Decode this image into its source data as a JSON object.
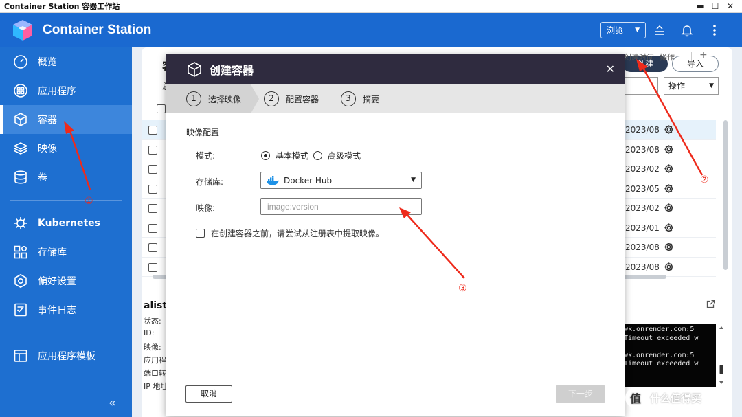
{
  "os": {
    "title": "Container Station 容器工作站",
    "min": "▬",
    "max": "☐",
    "close": "✕"
  },
  "header": {
    "app_name": "Container Station",
    "browse_label": "浏览",
    "browse_caret": "▼"
  },
  "sidebar": {
    "items": [
      {
        "label": "概览",
        "icon": "gauge-icon"
      },
      {
        "label": "应用程序",
        "icon": "apps-icon"
      },
      {
        "label": "容器",
        "icon": "cube-icon",
        "active": true
      },
      {
        "label": "映像",
        "icon": "layers-icon"
      },
      {
        "label": "卷",
        "icon": "database-icon"
      }
    ],
    "items2": [
      {
        "label": "Kubernetes",
        "icon": "helm-icon"
      },
      {
        "label": "存储库",
        "icon": "registry-icon"
      },
      {
        "label": "偏好设置",
        "icon": "settings-icon"
      },
      {
        "label": "事件日志",
        "icon": "log-icon"
      }
    ],
    "items3": [
      {
        "label": "应用程序模板",
        "icon": "template-icon"
      }
    ],
    "collapse": "«"
  },
  "main": {
    "title": "容",
    "sub": "总计",
    "create_label": "创建",
    "import_label": "导入",
    "ops_label": "操作",
    "ops_caret": "▼",
    "col_created": "创建时间",
    "col_ops": "操作",
    "col_plus": "+",
    "rows": [
      {
        "date": "2023/08"
      },
      {
        "date": "2023/08"
      },
      {
        "date": "2023/02"
      },
      {
        "date": "2023/05"
      },
      {
        "date": "2023/02"
      },
      {
        "date": "2023/01"
      },
      {
        "date": "2023/08"
      },
      {
        "date": "2023/08"
      }
    ]
  },
  "detail": {
    "name": "alist",
    "labels": [
      "状态:",
      "ID:",
      "映像:",
      "应用程",
      "端口转",
      "IP 地址"
    ],
    "terminal": "wk.onrender.com:5\nTimeout exceeded w\n\nwk.onrender.com:5\nTimeout exceeded w"
  },
  "modal": {
    "title": "创建容器",
    "close": "✕",
    "steps": [
      {
        "num": "1",
        "label": "选择映像"
      },
      {
        "num": "2",
        "label": "配置容器"
      },
      {
        "num": "3",
        "label": "摘要"
      }
    ],
    "section": "映像配置",
    "mode_label": "模式:",
    "mode_basic": "基本模式",
    "mode_advanced": "高级模式",
    "registry_label": "存储库:",
    "registry_value": "Docker Hub",
    "registry_caret": "▼",
    "image_label": "映像:",
    "image_placeholder": "image:version",
    "pull_check": "在创建容器之前，请尝试从注册表中提取映像。",
    "cancel": "取消",
    "next": "下一步"
  },
  "annotations": {
    "a1": "①",
    "a2": "②",
    "a3": "③",
    "color": "#ee2a1b"
  },
  "watermark": {
    "text": "什么值得买",
    "badge": "值"
  }
}
